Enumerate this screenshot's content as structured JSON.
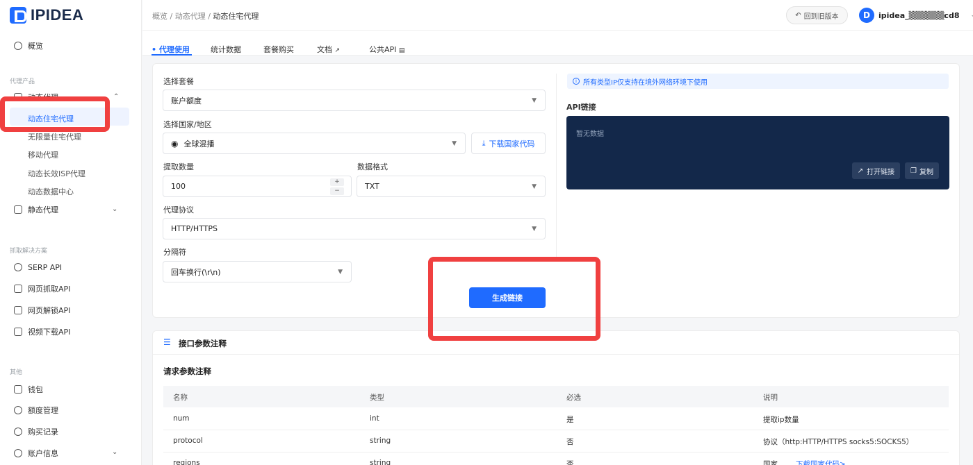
{
  "brand": {
    "name": "IPIDEA"
  },
  "sidebar": {
    "overview": "概览",
    "section_proxy": "代理产品",
    "dynamic_proxy": "动态代理",
    "dynamic_children": [
      "动态住宅代理",
      "无限量住宅代理",
      "移动代理",
      "动态长效ISP代理",
      "动态数据中心"
    ],
    "static_proxy": "静态代理",
    "section_scrape": "抓取解决方案",
    "scrape_items": [
      "SERP API",
      "网页抓取API",
      "网页解锁API",
      "视频下载API"
    ],
    "section_other": "其他",
    "other_items": [
      "钱包",
      "额度管理",
      "购买记录",
      "账户信息"
    ]
  },
  "header": {
    "breadcrumb": [
      "概览 /",
      "动态代理 /",
      "动态住宅代理"
    ],
    "old_version": "回到旧版本",
    "avatar_letter": "D",
    "username": "ipidea_▒▒▒▒▒▒cd8"
  },
  "tabs": [
    "• 代理使用",
    "统计数据",
    "套餐购买",
    "文档",
    "公共API"
  ],
  "form": {
    "package_label": "选择套餐",
    "package_value": "账户额度",
    "country_label": "选择国家/地区",
    "country_value": "全球混播",
    "download_country": "下载国家代码",
    "quantity_label": "提取数量",
    "quantity_value": "100",
    "format_label": "数据格式",
    "format_value": "TXT",
    "protocol_label": "代理协议",
    "protocol_value": "HTTP/HTTPS",
    "separator_label": "分隔符",
    "separator_value": "回车换行(\\r\\n)",
    "generate": "生成链接"
  },
  "api": {
    "notice": "所有类型IP仅支持在境外网络环境下使用",
    "link_label": "API链接",
    "empty": "暂无数据",
    "open_link": "打开链接",
    "copy": "复制"
  },
  "params": {
    "title": "接口参数注释",
    "subtitle": "请求参数注释",
    "columns": [
      "名称",
      "类型",
      "必选",
      "说明"
    ],
    "rows": [
      [
        "num",
        "int",
        "是",
        "提取ip数量"
      ],
      [
        "protocol",
        "string",
        "否",
        "协议（http:HTTP/HTTPS socks5:SOCKS5）"
      ],
      [
        "regions",
        "string",
        "否",
        "国家"
      ]
    ],
    "download_link": "下载国家代码>"
  },
  "colors": {
    "accent": "#1f6bff",
    "highlight": "#f04040",
    "api_box": "#13284a"
  }
}
